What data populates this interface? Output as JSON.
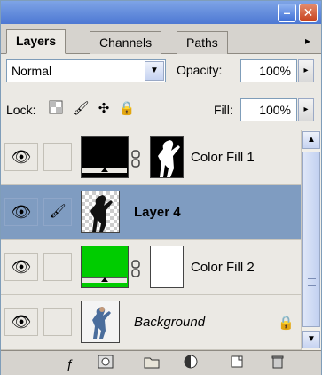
{
  "title_bar": {
    "minimize_glyph": "–",
    "close_glyph": "✕"
  },
  "tabs": [
    {
      "label": "Layers",
      "active": true
    },
    {
      "label": "Channels",
      "active": false
    },
    {
      "label": "Paths",
      "active": false
    }
  ],
  "tab_menu_glyph": "▸",
  "blend_mode": {
    "value": "Normal",
    "arrow": "▼"
  },
  "opacity": {
    "label": "Opacity:",
    "value": "100%",
    "arrow": "▸"
  },
  "lock": {
    "label": "Lock:",
    "icons": [
      "lock-transparent-icon",
      "lock-image-icon",
      "lock-position-icon",
      "lock-all-icon"
    ]
  },
  "fill": {
    "label": "Fill:",
    "value": "100%",
    "arrow": "▸"
  },
  "layers": [
    {
      "name": "Color Fill 1",
      "style": "normal",
      "visible": true,
      "has_mask": true,
      "fill_color": "#000000",
      "selected": false
    },
    {
      "name": "Layer 4",
      "style": "bold",
      "visible": true,
      "has_mask": false,
      "selected": true
    },
    {
      "name": "Color Fill 2",
      "style": "normal",
      "visible": true,
      "has_mask": true,
      "fill_color": "#00cc00",
      "selected": false
    },
    {
      "name": "Background",
      "style": "italic",
      "visible": true,
      "has_mask": false,
      "locked": true,
      "selected": false
    }
  ],
  "glyphs": {
    "eye": "👁",
    "brush": "🖌",
    "chain": "⛓",
    "lock": "🔒"
  },
  "toolbar": {
    "icons": [
      "link-layers-icon",
      "layer-style-icon",
      "add-mask-icon",
      "new-group-icon",
      "adjustment-layer-icon",
      "new-layer-icon",
      "delete-layer-icon"
    ]
  },
  "colors": {
    "selected_row": "#7f9cc1",
    "fill_black": "#000000",
    "fill_green": "#00cc00"
  }
}
